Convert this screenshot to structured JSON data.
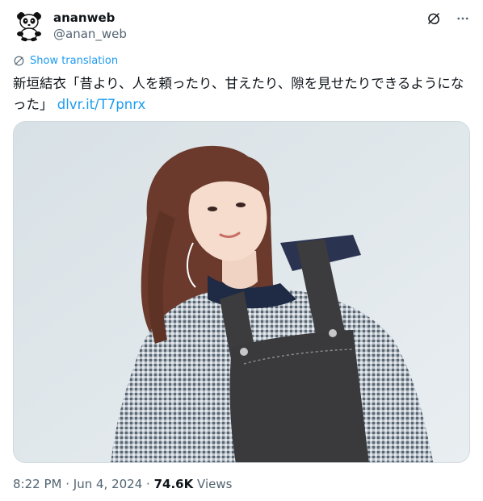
{
  "author": {
    "display_name": "ananweb",
    "handle": "@anan_web",
    "avatar_icon": "panda-icon"
  },
  "actions": {
    "grok_icon": "grok-icon",
    "more_icon": "more-horizontal-icon"
  },
  "translation": {
    "label": "Show translation",
    "icon": "translate-globe-icon"
  },
  "tweet": {
    "text": "新垣結衣「昔より、人を頼ったり、甘えたり、隙を見せたりできるようになった」",
    "link": "dlvr.it/T7pnrx"
  },
  "media": {
    "type": "photo"
  },
  "meta": {
    "time": "8:22 PM",
    "separator": "·",
    "date": "Jun 4, 2024",
    "views_count": "74.6K",
    "views_label": "Views"
  },
  "colors": {
    "accent": "#1d9bf0",
    "text_primary": "#0f1419",
    "text_secondary": "#536471",
    "border": "#cfd9de"
  }
}
